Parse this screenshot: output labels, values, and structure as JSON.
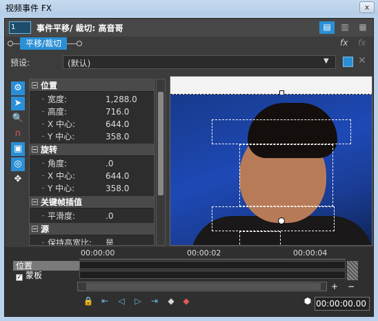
{
  "window": {
    "title": "视频事件 FX",
    "close": "x"
  },
  "header": {
    "track_label": "1",
    "title": "事件平移/ 裁切: 高音哥",
    "view_buttons": [
      "▤",
      "▥",
      "▦"
    ]
  },
  "chain": {
    "plugin": "平移/裁切",
    "fx_button": "fx",
    "fx_button2": "fx"
  },
  "preset": {
    "label": "预设:",
    "value": "(默认)",
    "dropdown": "▼",
    "delete": "✕"
  },
  "tools": [
    {
      "name": "gear-icon",
      "glyph": "⚙",
      "active": true
    },
    {
      "name": "pointer-icon",
      "glyph": "➤",
      "active": true
    },
    {
      "name": "zoom-icon",
      "glyph": "🔍",
      "active": false
    },
    {
      "name": "magnet-icon",
      "glyph": "∩",
      "active": false
    },
    {
      "name": "lock-aspect-icon",
      "glyph": "▣",
      "active": true
    },
    {
      "name": "scale-center-icon",
      "glyph": "◎",
      "active": true
    },
    {
      "name": "move-icon",
      "glyph": "✥",
      "active": false
    }
  ],
  "properties": {
    "position": {
      "header": "位置",
      "rows": [
        {
          "k": "宽度:",
          "v": "1,288.0"
        },
        {
          "k": "高度:",
          "v": "716.0"
        },
        {
          "k": "X 中心:",
          "v": "644.0"
        },
        {
          "k": "Y 中心:",
          "v": "358.0"
        }
      ]
    },
    "rotation": {
      "header": "旋转",
      "rows": [
        {
          "k": "角度:",
          "v": ".0"
        },
        {
          "k": "X 中心:",
          "v": "644.0"
        },
        {
          "k": "Y 中心:",
          "v": "358.0"
        }
      ]
    },
    "keyframe": {
      "header": "关键帧插值",
      "rows": [
        {
          "k": "平滑度:",
          "v": ".0"
        }
      ]
    },
    "source": {
      "header": "源",
      "rows": [
        {
          "k": "保持高宽比:",
          "v": "是"
        }
      ]
    }
  },
  "timeline": {
    "rows": [
      {
        "label": "位置"
      },
      {
        "label": "蒙板",
        "checked": true
      }
    ],
    "times": [
      "00:00:00",
      "00:00:02",
      "00:00:04"
    ],
    "timecode": "00:00:00.00",
    "zoom_in": "+",
    "zoom_out": "−"
  }
}
